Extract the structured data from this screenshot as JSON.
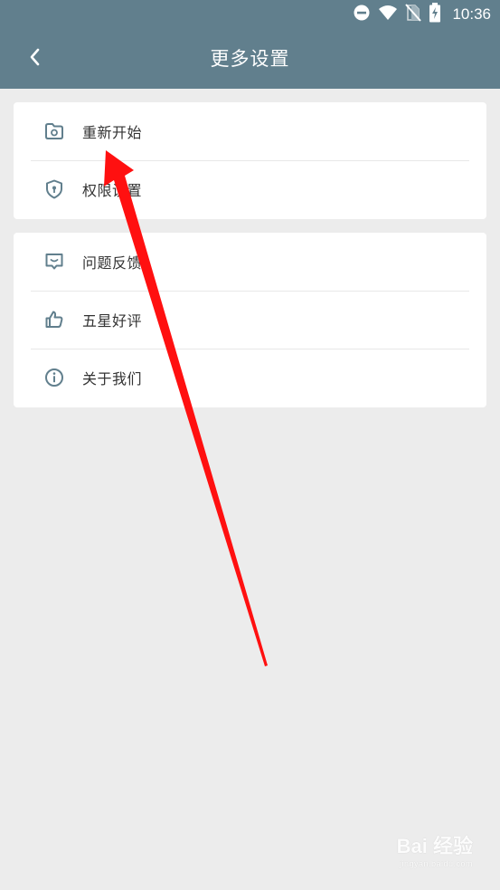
{
  "status_bar": {
    "time": "10:36",
    "icons": [
      "do-not-disturb-icon",
      "wifi-icon",
      "no-sim-icon",
      "battery-charging-icon"
    ]
  },
  "header": {
    "title": "更多设置",
    "back_icon": "chevron-left-icon",
    "background": "#617f8d"
  },
  "menu_groups": [
    {
      "items": [
        {
          "label": "重新开始",
          "icon": "folder-restart-icon"
        },
        {
          "label": "权限设置",
          "icon": "shield-key-icon"
        }
      ]
    },
    {
      "items": [
        {
          "label": "问题反馈",
          "icon": "feedback-icon"
        },
        {
          "label": "五星好评",
          "icon": "thumbs-up-icon"
        },
        {
          "label": "关于我们",
          "icon": "info-icon"
        }
      ]
    }
  ],
  "annotation": {
    "type": "red-arrow",
    "color": "#ff0000",
    "points_to": "重新开始"
  },
  "watermark": {
    "brand": "Bai 经验",
    "url": "jingyan.baidu.com"
  },
  "colors": {
    "page_background": "#ececec",
    "icon_color": "#617f8d",
    "text_color": "#333333"
  }
}
